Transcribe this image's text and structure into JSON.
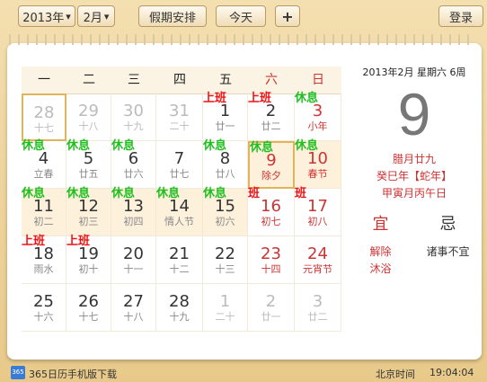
{
  "toolbar": {
    "year": "2013年",
    "month": "2月",
    "holiday_btn": "假期安排",
    "today_btn": "今天",
    "add_btn": "+",
    "login_btn": "登录"
  },
  "weekdays": [
    "一",
    "二",
    "三",
    "四",
    "五",
    "六",
    "日"
  ],
  "days": [
    {
      "d": "28",
      "l": "十七",
      "other": true,
      "selected": true
    },
    {
      "d": "29",
      "l": "十八",
      "other": true
    },
    {
      "d": "30",
      "l": "十九",
      "other": true
    },
    {
      "d": "31",
      "l": "二十",
      "other": true
    },
    {
      "d": "1",
      "l": "廿一",
      "tag": "上班",
      "tagtype": "ban"
    },
    {
      "d": "2",
      "l": "廿二",
      "tag": "上班",
      "tagtype": "ban"
    },
    {
      "d": "3",
      "l": "小年",
      "tag": "休息",
      "tagtype": "xi",
      "red": true
    },
    {
      "d": "4",
      "l": "立春",
      "tag": "休息",
      "tagtype": "xi"
    },
    {
      "d": "5",
      "l": "廿五",
      "tag": "休息",
      "tagtype": "xi"
    },
    {
      "d": "6",
      "l": "廿六",
      "tag": "休息",
      "tagtype": "xi"
    },
    {
      "d": "7",
      "l": "廿七"
    },
    {
      "d": "8",
      "l": "廿八",
      "tag": "休息",
      "tagtype": "xi"
    },
    {
      "d": "9",
      "l": "除夕",
      "tag": "休息",
      "tagtype": "xi",
      "red": true,
      "hl": true,
      "today": true
    },
    {
      "d": "10",
      "l": "春节",
      "tag": "休息",
      "tagtype": "xi",
      "red": true,
      "hl": true
    },
    {
      "d": "11",
      "l": "初二",
      "tag": "休息",
      "tagtype": "xi",
      "hl": true
    },
    {
      "d": "12",
      "l": "初三",
      "tag": "休息",
      "tagtype": "xi",
      "hl": true
    },
    {
      "d": "13",
      "l": "初四",
      "tag": "休息",
      "tagtype": "xi",
      "hl": true
    },
    {
      "d": "14",
      "l": "情人节",
      "tag": "休息",
      "tagtype": "xi",
      "hl": true
    },
    {
      "d": "15",
      "l": "初六",
      "tag": "休息",
      "tagtype": "xi",
      "hl": true
    },
    {
      "d": "16",
      "l": "初七",
      "tag": "班",
      "tagtype": "ban",
      "red": true
    },
    {
      "d": "17",
      "l": "初八",
      "tag": "班",
      "tagtype": "ban",
      "red": true
    },
    {
      "d": "18",
      "l": "雨水",
      "tag": "上班",
      "tagtype": "ban"
    },
    {
      "d": "19",
      "l": "初十",
      "tag": "上班",
      "tagtype": "ban"
    },
    {
      "d": "20",
      "l": "十一"
    },
    {
      "d": "21",
      "l": "十二"
    },
    {
      "d": "22",
      "l": "十三"
    },
    {
      "d": "23",
      "l": "十四",
      "red": true
    },
    {
      "d": "24",
      "l": "元宵节",
      "red": true
    },
    {
      "d": "25",
      "l": "十六"
    },
    {
      "d": "26",
      "l": "十七"
    },
    {
      "d": "27",
      "l": "十八"
    },
    {
      "d": "28",
      "l": "十九"
    },
    {
      "d": "1",
      "l": "二十",
      "other": true
    },
    {
      "d": "2",
      "l": "廿一",
      "other": true
    },
    {
      "d": "3",
      "l": "廿二",
      "other": true
    }
  ],
  "side": {
    "header": "2013年2月  星期六  6周",
    "big_day": "9",
    "lunar": "腊月廿九",
    "ganzhi_year": "癸巳年【蛇年】",
    "ganzhi_mday": "甲寅月丙午日",
    "yi_label": "宜",
    "ji_label": "忌",
    "yi_items": [
      "解除",
      "沐浴"
    ],
    "ji_items": [
      "诸事不宜"
    ]
  },
  "footer": {
    "app_text": "365日历手机版下载",
    "icon_text": "365",
    "time_label": "北京时间",
    "time": "19:04:04"
  }
}
